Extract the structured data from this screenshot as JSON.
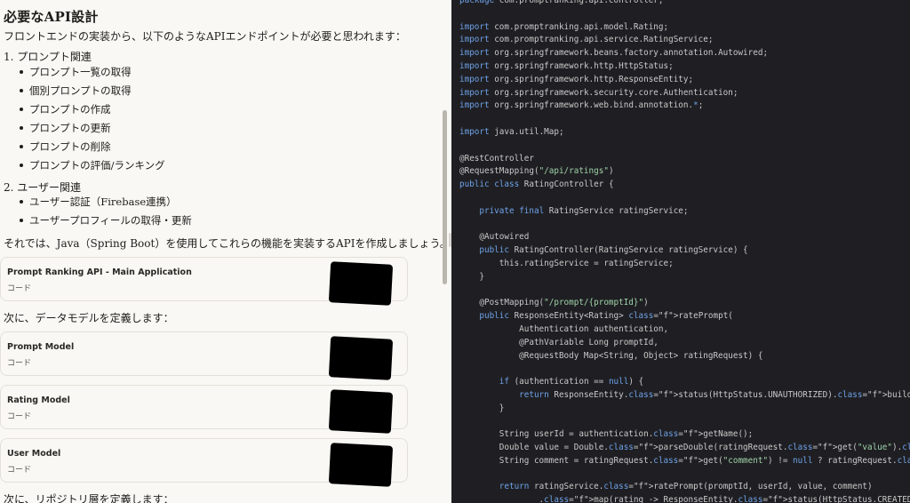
{
  "doc": {
    "heading": "必要なAPI設計",
    "intro": "フロントエンドの実装から、以下のようなAPIエンドポイントが必要と思われます：",
    "sections": [
      {
        "title": "1. プロンプト関連",
        "items": [
          "プロンプト一覧の取得",
          "個別プロンプトの取得",
          "プロンプトの作成",
          "プロンプトの更新",
          "プロンプトの削除",
          "プロンプトの評価/ランキング"
        ]
      },
      {
        "title": "2. ユーザー関連",
        "items": [
          "ユーザー認証（Firebase連携）",
          "ユーザープロフィールの取得・更新"
        ]
      }
    ],
    "lead": "それでは、Java（Spring Boot）を使用してこれらの機能を実装するAPIを作成しましょう。",
    "models_intro": "次に、データモデルを定義します：",
    "repo_intro": "次に、リポジトリ層を定義します：",
    "artifacts": [
      {
        "title": "Prompt Ranking API - Main Application",
        "subtitle": "コード"
      },
      {
        "title": "Prompt Model",
        "subtitle": "コード"
      },
      {
        "title": "Rating Model",
        "subtitle": "コード"
      },
      {
        "title": "User Model",
        "subtitle": "コード"
      }
    ]
  },
  "code": {
    "lines": [
      "package com.promptranking.api.controller;",
      "",
      "import com.promptranking.api.model.Rating;",
      "import com.promptranking.api.service.RatingService;",
      "import org.springframework.beans.factory.annotation.Autowired;",
      "import org.springframework.http.HttpStatus;",
      "import org.springframework.http.ResponseEntity;",
      "import org.springframework.security.core.Authentication;",
      "import org.springframework.web.bind.annotation.*;",
      "",
      "import java.util.Map;",
      "",
      "@RestController",
      "@RequestMapping(\"/api/ratings\")",
      "public class RatingController {",
      "",
      "    private final RatingService ratingService;",
      "",
      "    @Autowired",
      "    public RatingController(RatingService ratingService) {",
      "        this.ratingService = ratingService;",
      "    }",
      "",
      "    @PostMapping(\"/prompt/{promptId}\")",
      "    public ResponseEntity<Rating> ratePrompt(",
      "            Authentication authentication,",
      "            @PathVariable Long promptId,",
      "            @RequestBody Map<String, Object> ratingRequest) {",
      "",
      "        if (authentication == null) {",
      "            return ResponseEntity.status(HttpStatus.UNAUTHORIZED).build();",
      "        }",
      "",
      "        String userId = authentication.getName();",
      "        Double value = Double.parseDouble(ratingRequest.get(\"value\").toString());",
      "        String comment = ratingRequest.get(\"comment\") != null ? ratingRequest.get(\"comment\").toString() : null;",
      "",
      "        return ratingService.ratePrompt(promptId, userId, value, comment)",
      "                .map(rating -> ResponseEntity.status(HttpStatus.CREATED).body(rating))"
    ]
  },
  "colors": {
    "doc_bg": "#f9f8f4",
    "code_bg": "#1f1f23",
    "keyword": "#6ea2e8",
    "string": "#9fd3a8"
  }
}
